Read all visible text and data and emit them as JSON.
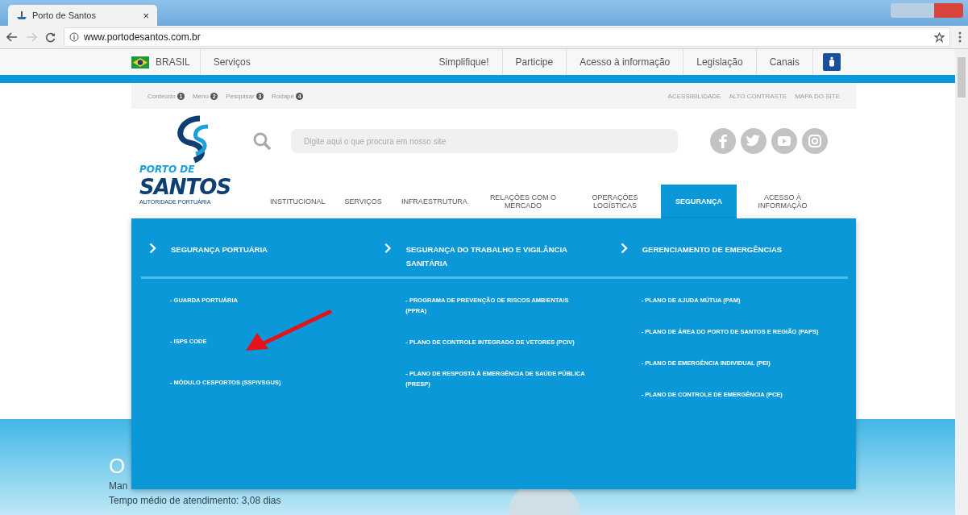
{
  "browser": {
    "tab_title": "Porto de Santos",
    "tab_close": "×",
    "url": "www.portodesantos.com.br"
  },
  "gov_bar": {
    "country": "BRASIL",
    "links": [
      "Serviços",
      "Simplifique!",
      "Participe",
      "Acesso à informação",
      "Legislação",
      "Canais"
    ]
  },
  "accessibility_bar": {
    "shortcuts": [
      {
        "label": "Conteúdo",
        "key": "1"
      },
      {
        "label": "Menu",
        "key": "2"
      },
      {
        "label": "Pesquisar",
        "key": "3"
      },
      {
        "label": "Rodapé",
        "key": "4"
      }
    ],
    "links": [
      "ACESSIBILIDADE",
      "ALTO CONTRASTE",
      "MAPA DO SITE"
    ]
  },
  "header": {
    "logo": {
      "line1": "PORTO DE",
      "line2": "SANTOS",
      "tagline": "AUTORIDADE PORTUÁRIA"
    },
    "search": {
      "placeholder": "Digite aqui o que procura em nosso site"
    },
    "nav": [
      {
        "label": "INSTITUCIONAL",
        "selected": false
      },
      {
        "label": "SERVIÇOS",
        "selected": false
      },
      {
        "label": "INFRAESTRUTURA",
        "selected": false
      },
      {
        "label": "RELAÇÕES COM O MERCADO",
        "selected": false
      },
      {
        "label": "OPERAÇÕES LOGÍSTICAS",
        "selected": false
      },
      {
        "label": "SEGURANÇA",
        "selected": true
      },
      {
        "label": "ACESSO À INFORMAÇÃO",
        "selected": false
      }
    ]
  },
  "dropdown": {
    "columns": [
      {
        "heading": "SEGURANÇA PORTUÁRIA",
        "items": [
          "- GUARDA PORTUÁRIA",
          "- ISPS CODE",
          "- MÓDULO CESPORTOS (SSP/VSGUS)"
        ]
      },
      {
        "heading": "SEGURANÇA DO TRABALHO E VIGILÂNCIA SANITÁRIA",
        "items": [
          "- PROGRAMA DE PREVENÇÃO DE RISCOS AMBIENTAIS (PPRA)",
          "- PLANO DE CONTROLE INTEGRADO DE VETORES (PCIV)",
          "- PLANO DE RESPOSTA À EMERGÊNCIA DE SAÚDE PÚBLICA (PRESP)"
        ]
      },
      {
        "heading": "GERENCIAMENTO DE EMERGÊNCIAS",
        "items": [
          "- PLANO DE AJUDA MÚTUA (PAM)",
          "- PLANO DE ÁREA DO PORTO DE SANTOS E REGIÃO (PAPS)",
          "- PLANO DE EMERGÊNCIA INDIVIDUAL (PEI)",
          "- PLANO DE CONTROLE DE EMERGÊNCIA (PCE)"
        ]
      }
    ]
  },
  "hero": {
    "title": "O",
    "lines": [
      "Man",
      "Tempo médio de atendimento: 3,08 dias"
    ]
  }
}
